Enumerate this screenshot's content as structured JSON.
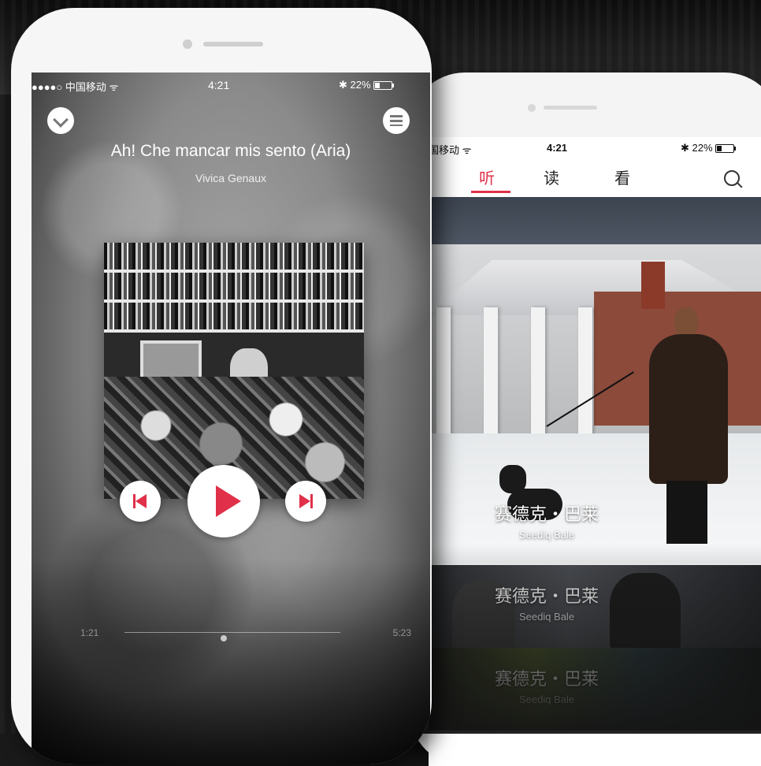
{
  "colors": {
    "accent": "#e0304a",
    "status_text_dark": "#111111",
    "status_text_light": "#ffffff"
  },
  "left_phone": {
    "status_bar": {
      "carrier": "●●●●○ 中国移动 ᯤ",
      "time": "4:21",
      "battery": "✱ 22%"
    },
    "collapse_icon": "chevron-down-icon",
    "playlist_icon": "menu-icon",
    "song": {
      "title": "Ah! Che mancar mis sento (Aria)",
      "artist": "Vivica Genaux"
    },
    "controls": {
      "prev_icon": "skip-previous-icon",
      "play_icon": "play-icon",
      "next_icon": "skip-next-icon"
    },
    "progress": {
      "elapsed": "1:21",
      "total": "5:23",
      "fraction": 0.46
    }
  },
  "right_phone": {
    "status_bar": {
      "carrier": "国移动 ᯤ",
      "time": "4:21",
      "battery": "✱ 22%"
    },
    "tabs": [
      {
        "label": "听",
        "active": true
      },
      {
        "label": "读",
        "active": false
      },
      {
        "label": "看",
        "active": false
      }
    ],
    "search_icon": "search-icon",
    "feed": [
      {
        "title_cn": "赛德克・巴莱",
        "title_en": "Seediq Bale"
      },
      {
        "title_cn": "赛德克・巴莱",
        "title_en": "Seediq Bale"
      },
      {
        "title_cn": "赛德克・巴莱",
        "title_en": "Seediq Bale"
      }
    ]
  }
}
